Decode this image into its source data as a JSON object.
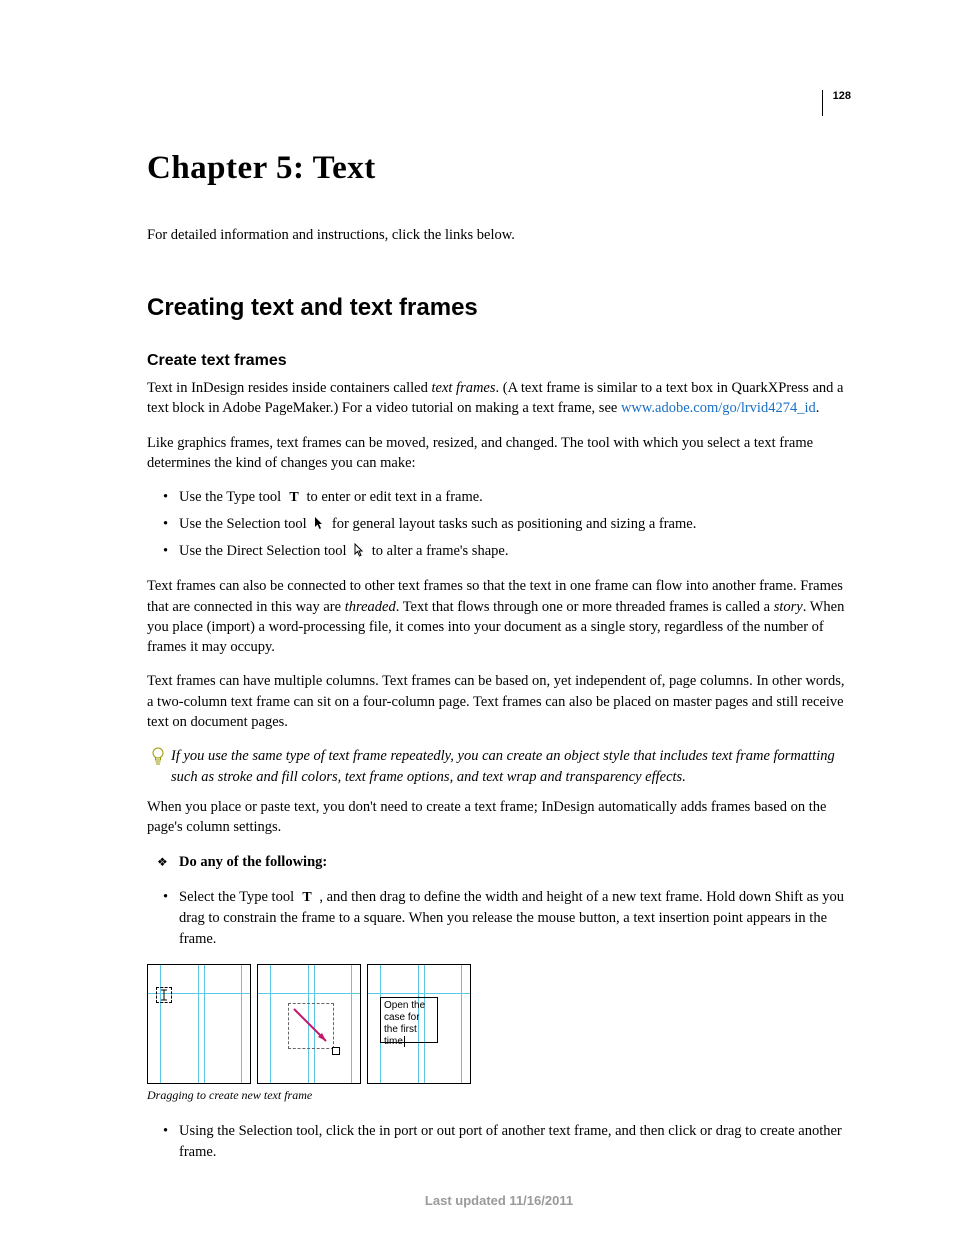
{
  "pageNumber": "128",
  "chapterTitle": "Chapter 5: Text",
  "intro": "For detailed information and instructions, click the links below.",
  "sectionTitle": "Creating text and text frames",
  "subsectionTitle": "Create text frames",
  "p1_a": "Text in InDesign resides inside containers called ",
  "p1_term": "text frames",
  "p1_b": ". (A text frame is similar to a text box in QuarkXPress and a text block in Adobe PageMaker.) For a video tutorial on making a text frame, see ",
  "p1_link": "www.adobe.com/go/lrvid4274_id",
  "p1_c": ".",
  "p2": "Like graphics frames, text frames can be moved, resized, and changed. The tool with which you select a text frame determines the kind of changes you can make:",
  "bullets1": {
    "b1_a": "Use the Type tool ",
    "b1_b": " to enter or edit text in a frame.",
    "b2_a": "Use the Selection tool ",
    "b2_b": " for general layout tasks such as positioning and sizing a frame.",
    "b3_a": "Use the Direct Selection tool ",
    "b3_b": " to alter a frame's shape."
  },
  "p3_a": "Text frames can also be connected to other text frames so that the text in one frame can flow into another frame. Frames that are connected in this way are ",
  "p3_term1": "threaded",
  "p3_b": ". Text that flows through one or more threaded frames is called a ",
  "p3_term2": "story",
  "p3_c": ". When you place (import) a word-processing file, it comes into your document as a single story, regardless of the number of frames it may occupy.",
  "p4": "Text frames can have multiple columns. Text frames can be based on, yet independent of, page columns. In other words, a two-column text frame can sit on a four-column page. Text frames can also be placed on master pages and still receive text on document pages.",
  "tip": "If you use the same type of text frame repeatedly, you can create an object style that includes text frame formatting such as stroke and fill colors, text frame options, and text wrap and transparency effects.",
  "p5": "When you place or paste text, you don't need to create a text frame; InDesign automatically adds frames based on the page's column settings.",
  "instr1": "Do any of the following:",
  "bullets2": {
    "b1_a": "Select the Type tool ",
    "b1_b": " , and then drag to define the width and height of a new text frame. Hold down Shift as you drag to constrain the frame to a square. When you release the mouse button, a text insertion point appears in the frame."
  },
  "figureText": "Open the case for the first time",
  "caption": "Dragging to create new text frame",
  "bullets3": {
    "b1": "Using the Selection tool, click the in port or out port of another text frame, and then click or drag to create another frame."
  },
  "footer": "Last updated 11/16/2011"
}
